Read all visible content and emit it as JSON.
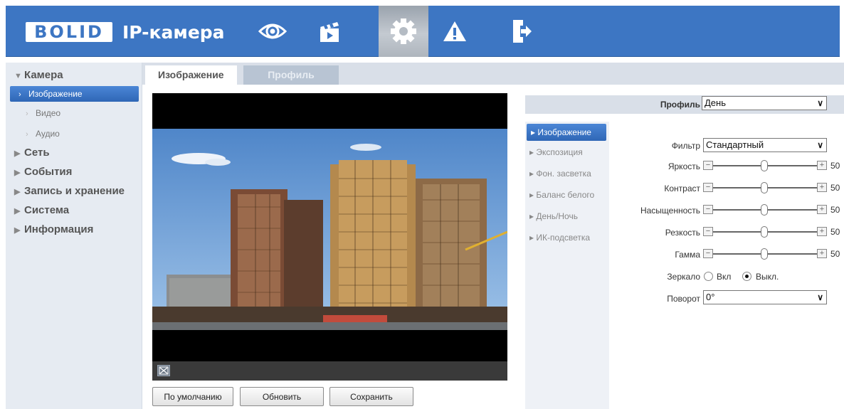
{
  "header": {
    "logo": "BOLID",
    "app_title": "IP-камера",
    "nav": [
      {
        "icon": "eye-icon",
        "active": false
      },
      {
        "icon": "clapperboard-icon",
        "active": false
      },
      {
        "icon": "gear-icon",
        "active": true
      },
      {
        "icon": "warning-icon",
        "active": false
      },
      {
        "icon": "exit-icon",
        "active": false
      }
    ]
  },
  "sidebar": {
    "groups": [
      {
        "label": "Камера",
        "expanded": true,
        "items": [
          {
            "label": "Изображение",
            "active": true
          },
          {
            "label": "Видео",
            "active": false
          },
          {
            "label": "Аудио",
            "active": false
          }
        ]
      },
      {
        "label": "Сеть"
      },
      {
        "label": "События"
      },
      {
        "label": "Запись и хранение"
      },
      {
        "label": "Система"
      },
      {
        "label": "Информация"
      }
    ]
  },
  "tabs": [
    {
      "label": "Изображение",
      "active": true
    },
    {
      "label": "Профиль",
      "active": false
    }
  ],
  "buttons": {
    "default": "По умолчанию",
    "refresh": "Обновить",
    "save": "Сохранить"
  },
  "settings": {
    "profile_label": "Профиль",
    "profile_value": "День",
    "subnav": [
      {
        "label": "Изображение",
        "active": true
      },
      {
        "label": "Экспозиция",
        "active": false
      },
      {
        "label": "Фон. засветка",
        "active": false
      },
      {
        "label": "Баланс белого",
        "active": false
      },
      {
        "label": "День/Ночь",
        "active": false
      },
      {
        "label": "ИК-подсветка",
        "active": false
      }
    ],
    "filter_label": "Фильтр",
    "filter_value": "Стандартный",
    "sliders": [
      {
        "label": "Яркость",
        "value": "50"
      },
      {
        "label": "Контраст",
        "value": "50"
      },
      {
        "label": "Насыщенность",
        "value": "50"
      },
      {
        "label": "Резкость",
        "value": "50"
      },
      {
        "label": "Гамма",
        "value": "50"
      }
    ],
    "mirror_label": "Зеркало",
    "mirror_on": "Вкл",
    "mirror_off": "Выкл.",
    "mirror_selected": "off",
    "rotate_label": "Поворот",
    "rotate_value": "0°"
  },
  "colors": {
    "header_blue": "#3d76c3",
    "active_blue": "#2f67b6",
    "sidebar_bg": "#e6ebf2"
  }
}
